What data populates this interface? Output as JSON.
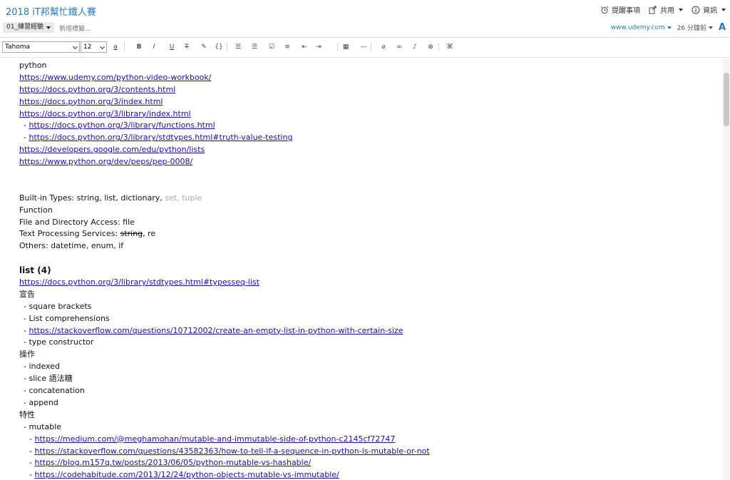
{
  "note": {
    "title": "2018 iT邦幫忙鐵人賽"
  },
  "top_actions": [
    {
      "label": "提醒事項",
      "icon": "alarm-clock-icon"
    },
    {
      "label": "共用",
      "icon": "share-icon"
    },
    {
      "label": "資訊",
      "icon": "info-icon"
    }
  ],
  "meta": {
    "notebook": "01_練習經驗",
    "tag_placeholder": "新增標籤...",
    "source_url": "www.udemy.com",
    "updated": "26 分鐘前",
    "font_icon_label": "A"
  },
  "toolbar": {
    "font_family": "Tahoma",
    "font_size": "12",
    "buttons": [
      {
        "name": "text-color-icon",
        "glyph": "a"
      },
      {
        "name": "bold-icon",
        "glyph": "B"
      },
      {
        "name": "italic-icon",
        "glyph": "I"
      },
      {
        "name": "underline-icon",
        "glyph": "U"
      },
      {
        "name": "strikethrough-icon",
        "glyph": "T"
      },
      {
        "name": "highlight-icon",
        "glyph": "✎"
      },
      {
        "name": "code-block-icon",
        "glyph": "{}"
      },
      {
        "name": "bulleted-list-icon",
        "glyph": "☰"
      },
      {
        "name": "numbered-list-icon",
        "glyph": "☰"
      },
      {
        "name": "checkbox-icon",
        "glyph": "☑"
      },
      {
        "name": "align-icon",
        "glyph": "≡"
      },
      {
        "name": "outdent-icon",
        "glyph": "⇤"
      },
      {
        "name": "indent-icon",
        "glyph": "⇥"
      },
      {
        "name": "table-icon",
        "glyph": "▦"
      },
      {
        "name": "horizontal-rule-icon",
        "glyph": "—"
      },
      {
        "name": "attachment-icon",
        "glyph": "⌀"
      },
      {
        "name": "link-icon",
        "glyph": "∞"
      },
      {
        "name": "audio-icon",
        "glyph": "♪"
      },
      {
        "name": "remove-format-icon",
        "glyph": "⊗"
      },
      {
        "name": "more-options-icon",
        "glyph": "⌘"
      }
    ]
  },
  "content": {
    "lines": [
      {
        "type": "text",
        "text": "python",
        "indent": 0
      },
      {
        "type": "link",
        "text": "https://www.udemy.com/python-video-workbook/",
        "indent": 0
      },
      {
        "type": "link",
        "text": "https://docs.python.org/3/contents.html",
        "indent": 0
      },
      {
        "type": "link",
        "text": "https://docs.python.org/3/index.html",
        "indent": 0
      },
      {
        "type": "link",
        "text": "https://docs.python.org/3/library/index.html",
        "indent": 0
      },
      {
        "type": "sublink",
        "prefix": "- ",
        "text": "https://docs.python.org/3/library/functions.html",
        "indent": 1
      },
      {
        "type": "sublink",
        "prefix": "- ",
        "text": "https://docs.python.org/3/library/stdtypes.html#truth-value-testing",
        "indent": 1
      },
      {
        "type": "link",
        "text": "https://developers.google.com/edu/python/lists",
        "indent": 0
      },
      {
        "type": "link",
        "text": "https://www.python.org/dev/peps/pep-0008/",
        "indent": 0
      },
      {
        "type": "blank"
      },
      {
        "type": "blank"
      },
      {
        "type": "builtin",
        "text": "Built-in Types: string, list, dictionary, ",
        "gray": "set, tuple"
      },
      {
        "type": "text",
        "text": "Function",
        "indent": 0
      },
      {
        "type": "text",
        "text": "File and Directory Access: file",
        "indent": 0
      },
      {
        "type": "strikeline",
        "before": "Text Processing Services: ",
        "struck": "string",
        "after": ", re"
      },
      {
        "type": "text",
        "text": "Others: datetime, enum, if",
        "indent": 0
      },
      {
        "type": "blank"
      },
      {
        "type": "heading",
        "text": "list (4)"
      },
      {
        "type": "link",
        "text": "https://docs.python.org/3/library/stdtypes.html#typesseq-list",
        "indent": 0
      },
      {
        "type": "text",
        "text": "宣告",
        "indent": 0
      },
      {
        "type": "text",
        "text": "- square brackets",
        "indent": 1
      },
      {
        "type": "text",
        "text": "- List comprehensions",
        "indent": 1
      },
      {
        "type": "sublink",
        "prefix": "- ",
        "text": "https://stackoverflow.com/questions/10712002/create-an-empty-list-in-python-with-certain-size",
        "indent": 1
      },
      {
        "type": "text",
        "text": "- type constructor",
        "indent": 1
      },
      {
        "type": "text",
        "text": "操作",
        "indent": 0
      },
      {
        "type": "text",
        "text": "- indexed",
        "indent": 1
      },
      {
        "type": "text",
        "text": "- slice 語法糖",
        "indent": 1
      },
      {
        "type": "text",
        "text": "- concatenation",
        "indent": 1
      },
      {
        "type": "text",
        "text": "- append",
        "indent": 1
      },
      {
        "type": "text",
        "text": "特性",
        "indent": 0
      },
      {
        "type": "text",
        "text": "- mutable",
        "indent": 1
      },
      {
        "type": "sublink",
        "prefix": "- ",
        "text": "https://medium.com/@meghamohan/mutable-and-immutable-side-of-python-c2145cf72747",
        "indent": 2
      },
      {
        "type": "sublink",
        "prefix": "- ",
        "text": "https://stackoverflow.com/questions/43582363/how-to-tell-if-a-sequence-in-python-is-mutable-or-not",
        "indent": 2
      },
      {
        "type": "sublink",
        "prefix": "- ",
        "text": "https://blog.m157q.tw/posts/2013/06/05/python-mutable-vs-hashable/",
        "indent": 2
      },
      {
        "type": "sublink",
        "prefix": "- ",
        "text": "https://codehabitude.com/2013/12/24/python-objects-mutable-vs-immutable/",
        "indent": 2
      }
    ]
  },
  "colors": {
    "accent": "#2a7ab8",
    "link": "#1a0dab",
    "muted": "#aaaaaa"
  }
}
